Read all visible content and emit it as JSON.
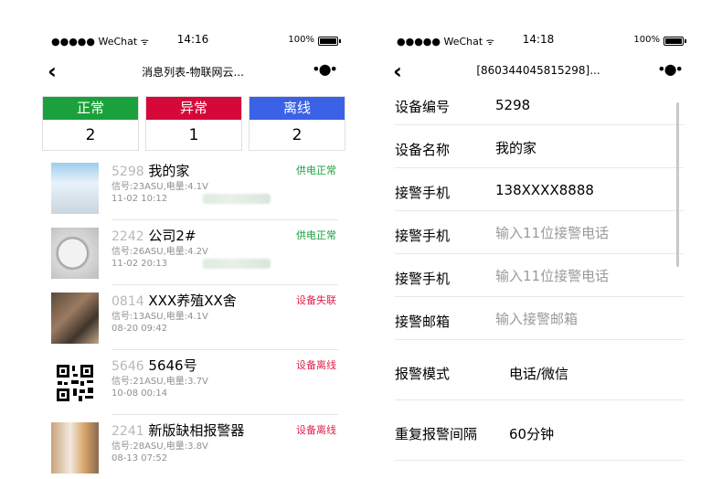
{
  "left": {
    "status": {
      "carrier": "●●●●● WeChat",
      "wifi": "ᯤ",
      "time": "14:16",
      "battery": "100%"
    },
    "nav": {
      "back": "‹",
      "title": "消息列表-物联网云...",
      "more": "•●•"
    },
    "cards": [
      {
        "label": "正常",
        "count": "2",
        "color": "#1aa13c"
      },
      {
        "label": "异常",
        "count": "1",
        "color": "#d6083a"
      },
      {
        "label": "离线",
        "count": "2",
        "color": "#3b62e6"
      }
    ],
    "devices": [
      {
        "code": "5298",
        "name": "我的家",
        "signal": "信号:23ASU,电量:4.1V",
        "time": "11-02 10:12",
        "state": "供电正常",
        "state_color": "#1aa13c"
      },
      {
        "code": "2242",
        "name": "公司2#",
        "signal": "信号:26ASU,电量:4.2V",
        "time": "11-02 20:13",
        "state": "供电正常",
        "state_color": "#1aa13c"
      },
      {
        "code": "0814",
        "name": "XXX养殖XX舍",
        "signal": "信号:13ASU,电量:4.1V",
        "time": "08-20 09:42",
        "state": "设备失联",
        "state_color": "#e0204a"
      },
      {
        "code": "5646",
        "name": "5646号",
        "signal": "信号:21ASU,电量:3.7V",
        "time": "10-08 00:14",
        "state": "设备离线",
        "state_color": "#e0204a"
      },
      {
        "code": "2241",
        "name": "新版缺相报警器",
        "signal": "信号:28ASU,电量:3.8V",
        "time": "08-13 07:52",
        "state": "设备离线",
        "state_color": "#e0204a"
      }
    ]
  },
  "right": {
    "status": {
      "carrier": "●●●●● WeChat",
      "wifi": "ᯤ",
      "time": "14:18",
      "battery": "100%"
    },
    "nav": {
      "back": "‹",
      "title": "[860344045815298]...",
      "more": "•●•"
    },
    "rows": {
      "device_no": {
        "label": "设备编号",
        "value": "5298"
      },
      "device_name": {
        "label": "设备名称",
        "value": "我的家"
      },
      "phone1": {
        "label": "接警手机",
        "value": "138XXXX8888"
      },
      "phone2": {
        "label": "接警手机",
        "placeholder": "输入11位接警电话"
      },
      "phone3": {
        "label": "接警手机",
        "placeholder": "输入11位接警电话"
      },
      "email": {
        "label": "接警邮箱",
        "placeholder": "输入接警邮箱"
      },
      "mode": {
        "label": "报警模式",
        "value": "电话/微信"
      },
      "interval": {
        "label": "重复报警间隔",
        "value": "60分钟"
      }
    }
  }
}
